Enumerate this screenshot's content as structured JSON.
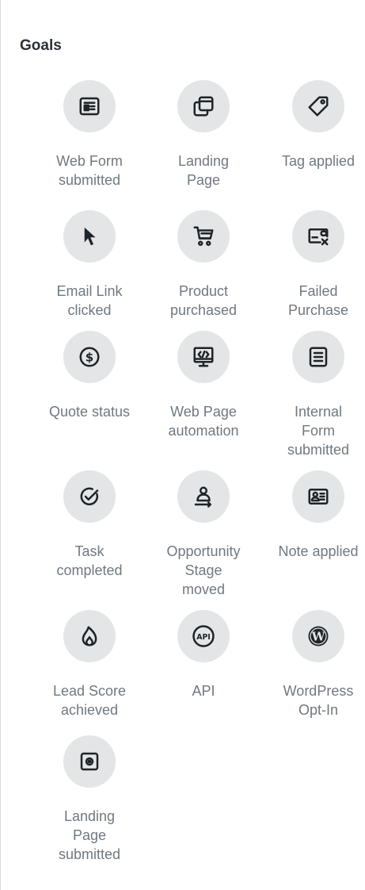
{
  "panel": {
    "title": "Goals"
  },
  "goals": [
    {
      "label": "Web Form\nsubmitted",
      "icon": "web-form-icon"
    },
    {
      "label": "Landing\nPage",
      "icon": "landing-page-icon"
    },
    {
      "label": "Tag applied",
      "icon": "tag-icon"
    },
    {
      "label": "Email Link\nclicked",
      "icon": "cursor-icon"
    },
    {
      "label": "Product\npurchased",
      "icon": "cart-icon"
    },
    {
      "label": "Failed\nPurchase",
      "icon": "failed-card-icon"
    },
    {
      "label": "Quote status",
      "icon": "dollar-icon"
    },
    {
      "label": "Web Page\nautomation",
      "icon": "code-monitor-icon"
    },
    {
      "label": "Internal\nForm\nsubmitted",
      "icon": "form-document-icon"
    },
    {
      "label": "Task\ncompleted",
      "icon": "task-check-icon"
    },
    {
      "label": "Opportunity\nStage\nmoved",
      "icon": "opportunity-stage-icon"
    },
    {
      "label": "Note applied",
      "icon": "contact-card-icon"
    },
    {
      "label": "Lead Score\nachieved",
      "icon": "flame-icon"
    },
    {
      "label": "API",
      "icon": "api-icon",
      "icon_text": "API"
    },
    {
      "label": "WordPress\nOpt-In",
      "icon": "wordpress-icon",
      "icon_text": "W"
    },
    {
      "label": "Landing\nPage\nsubmitted",
      "icon": "landing-page-submitted-icon"
    }
  ]
}
